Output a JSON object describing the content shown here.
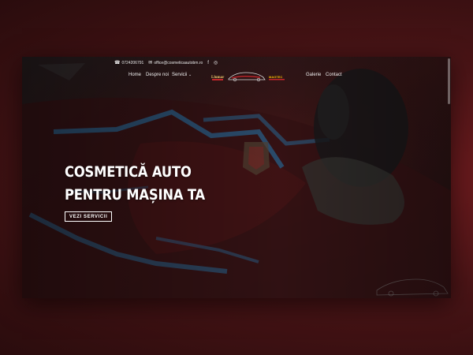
{
  "topbar": {
    "phone": "0724206791",
    "email": "office@cosmeticaautobm.ro",
    "social": [
      {
        "name": "facebook-icon",
        "glyph": "f"
      },
      {
        "name": "instagram-icon",
        "glyph": "◎"
      }
    ]
  },
  "nav": {
    "home": "Home",
    "about": "Despre noi",
    "services": "Servicii",
    "services_chevron": "⌄",
    "gallery": "Galerie",
    "contact": "Contact"
  },
  "logos": {
    "brand_small": "Llumar",
    "brand_right": "MAGTEC"
  },
  "hero": {
    "title_line1": "COSMETICĂ AUTO",
    "title_line2": "PENTRU MAȘINA TA",
    "cta_label": "VEZI SERVICII"
  },
  "colors": {
    "accent": "#c0252a",
    "text": "#ffffff",
    "tape": "#2f6fa0"
  }
}
